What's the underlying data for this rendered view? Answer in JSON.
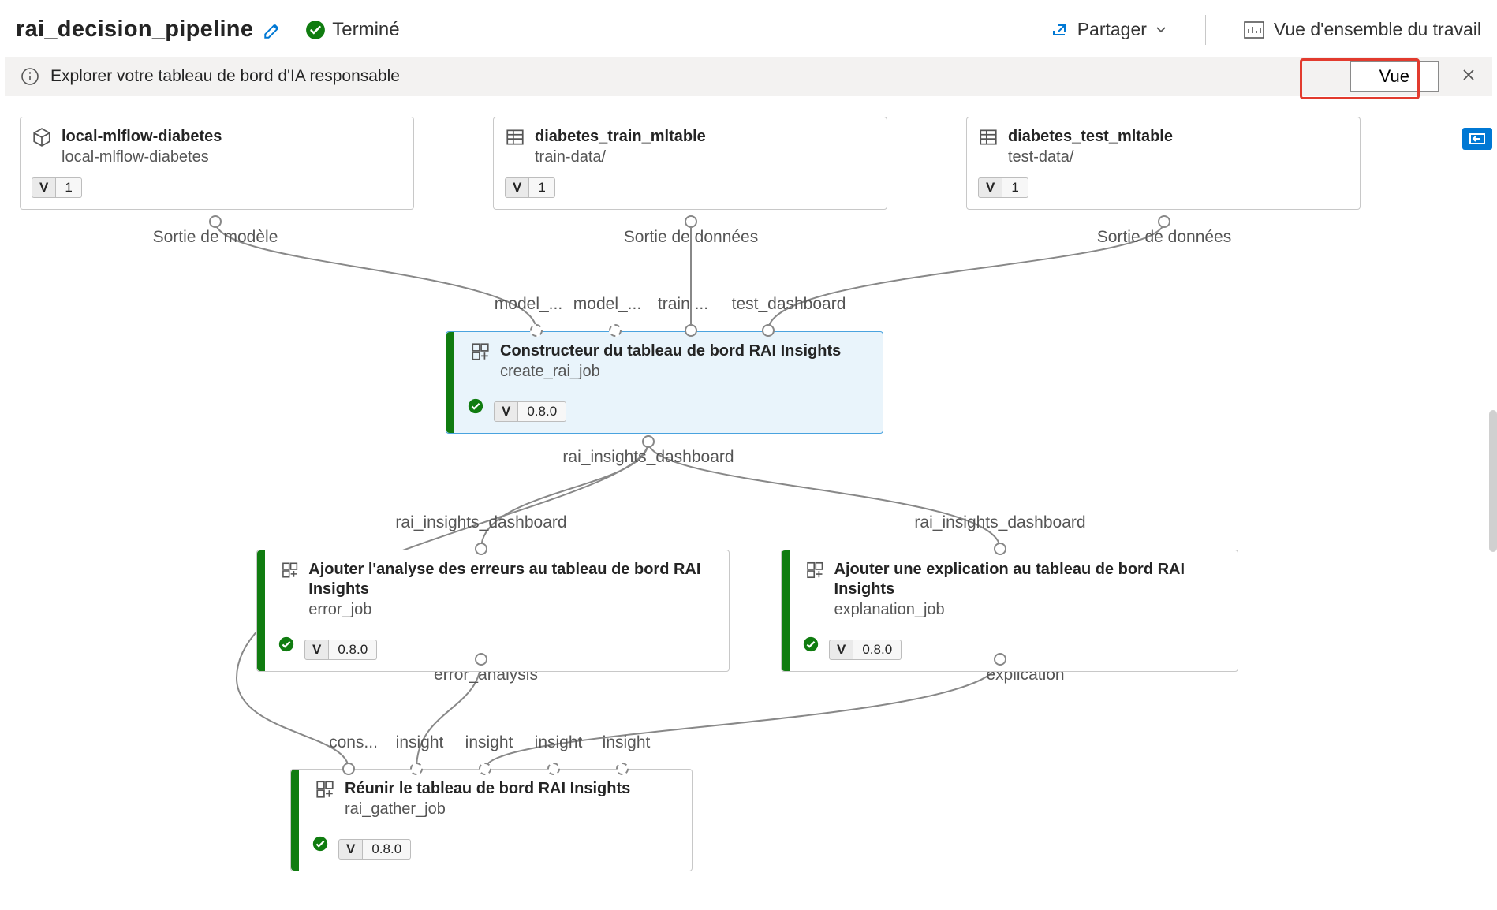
{
  "header": {
    "title": "rai_decision_pipeline",
    "status": "Terminé",
    "share": "Partager",
    "overview": "Vue d'ensemble du travail"
  },
  "infobar": {
    "text": "Explorer votre tableau de bord d'IA responsable",
    "view_btn": "Vue"
  },
  "nodes": {
    "model": {
      "title": "local-mlflow-diabetes",
      "sub": "local-mlflow-diabetes",
      "ver": "1"
    },
    "train": {
      "title": "diabetes_train_mltable",
      "sub": "train-data/",
      "ver": "1"
    },
    "test": {
      "title": "diabetes_test_mltable",
      "sub": "test-data/",
      "ver": "1"
    },
    "create": {
      "title": "Constructeur du tableau de bord RAI Insights",
      "sub": "create_rai_job",
      "ver": "0.8.0"
    },
    "error": {
      "title": "Ajouter l'analyse des erreurs au tableau de bord RAI Insights",
      "sub": "error_job",
      "ver": "0.8.0"
    },
    "explain": {
      "title": "Ajouter une explication au tableau de bord RAI Insights",
      "sub": "explanation_job",
      "ver": "0.8.0"
    },
    "gather": {
      "title": "Réunir le tableau de bord RAI Insights",
      "sub": "rai_gather_job",
      "ver": "0.8.0"
    }
  },
  "edge_labels": {
    "model_out": "Sortie de modèle",
    "data_out1": "Sortie de données",
    "data_out2": "Sortie de données",
    "in_model1": "model_...",
    "in_model2": "model_...",
    "in_train": "train ...",
    "in_test": "test_dashboard",
    "rai_out": "rai_insights_dashboard",
    "rai_in_l": "rai_insights_dashboard",
    "rai_in_r": "rai_insights_dashboard",
    "err_out": "error_analysis",
    "exp_out": "explication",
    "g_cons": "cons...",
    "g_i1": "insight",
    "g_i2": "insight",
    "g_i3": "insight",
    "g_i4": "insight"
  }
}
